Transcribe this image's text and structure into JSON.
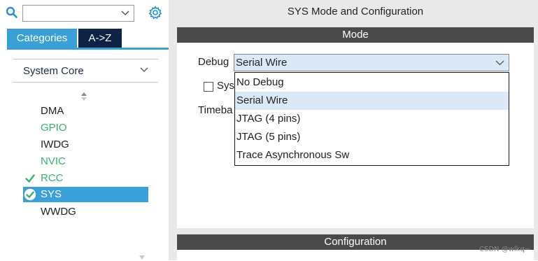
{
  "sidebar": {
    "search": {
      "value": "",
      "placeholder": ""
    },
    "tabs": [
      {
        "label": "Categories",
        "active": true
      },
      {
        "label": "A->Z",
        "active": false
      }
    ],
    "group": {
      "label": "System Core",
      "expanded": true
    },
    "items": [
      {
        "label": "DMA",
        "state": "default"
      },
      {
        "label": "GPIO",
        "state": "configured"
      },
      {
        "label": "IWDG",
        "state": "default"
      },
      {
        "label": "NVIC",
        "state": "configured"
      },
      {
        "label": "RCC",
        "state": "checked"
      },
      {
        "label": "SYS",
        "state": "selected"
      },
      {
        "label": "WWDG",
        "state": "default"
      }
    ]
  },
  "main": {
    "title": "SYS Mode and Configuration",
    "mode_header": "Mode",
    "debug": {
      "label": "Debug",
      "selected": "Serial Wire",
      "options": [
        "No Debug",
        "Serial Wire",
        "JTAG (4 pins)",
        "JTAG (5 pins)",
        "Trace Asynchronous Sw"
      ]
    },
    "sys_checkbox_partial": "Sys",
    "timebase_partial": "Timeba",
    "config_header": "Configuration"
  },
  "watermark": "CSDN @wlkq~",
  "colors": {
    "accent": "#3aa0d7",
    "dark_tab": "#0e2344",
    "configured_green": "#3cb371",
    "header_bar": "#4a4a4a",
    "selection": "#dbe8f6"
  }
}
